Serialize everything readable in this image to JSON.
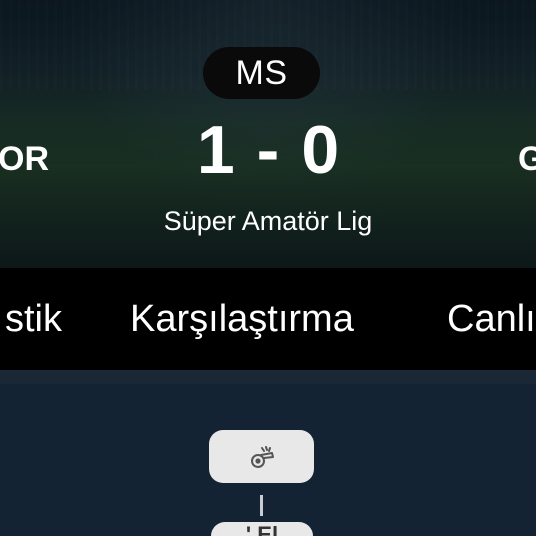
{
  "match": {
    "status": "MS",
    "home_score": "1",
    "separator": "-",
    "away_score": "0",
    "home_team": "OR",
    "away_team": "G",
    "league": "Süper Amatör Lig"
  },
  "tabs": [
    {
      "label": "stik"
    },
    {
      "label": "Karşılaştırma"
    },
    {
      "label": "Canlı"
    }
  ],
  "timeline": {
    "event_icon": "whistle-icon",
    "next_event_label": "' El"
  },
  "colors": {
    "background": "#132333",
    "tab_bar": "#000000",
    "pill": "#e8e8e8",
    "status_pill": "#0a0a0a"
  }
}
